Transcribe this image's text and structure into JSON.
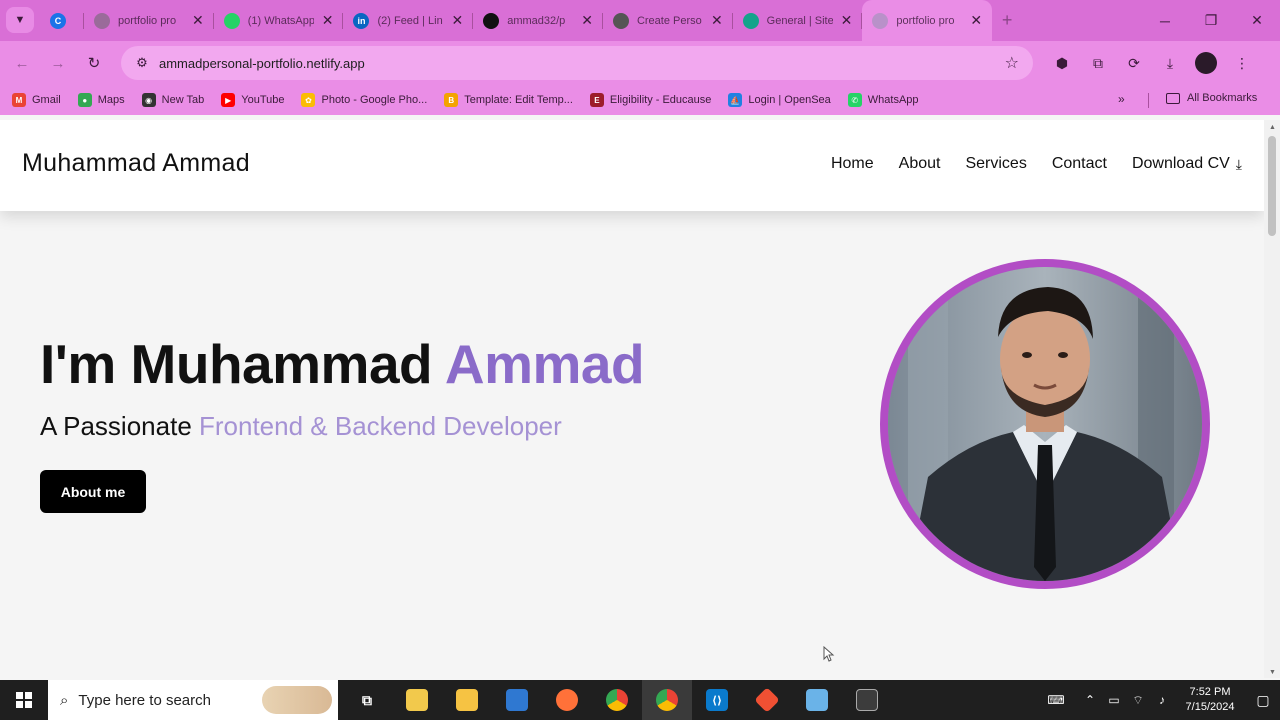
{
  "browser": {
    "tabs": [
      {
        "title": "",
        "favicon_color": "#1a73e8",
        "favicon_letter": "C"
      },
      {
        "title": "portfolio pro",
        "favicon_color": "#9a6b9a",
        "favicon_letter": ""
      },
      {
        "title": "(1) WhatsApp",
        "favicon_color": "#25d366",
        "favicon_letter": ""
      },
      {
        "title": "(2) Feed | Lin",
        "favicon_color": "#0a66c2",
        "favicon_letter": "in"
      },
      {
        "title": "ammad32/p",
        "favicon_color": "#111111",
        "favicon_letter": ""
      },
      {
        "title": "Create Perso",
        "favicon_color": "#555555",
        "favicon_letter": ""
      },
      {
        "title": "General | Site",
        "favicon_color": "#14a38b",
        "favicon_letter": ""
      },
      {
        "title": "portfolio pro",
        "favicon_color": "#b991c9",
        "favicon_letter": "",
        "active": true
      }
    ],
    "url": "ammadpersonal-portfolio.netlify.app",
    "bookmarks": [
      {
        "label": "Gmail",
        "color": "#ea4335",
        "letter": "M"
      },
      {
        "label": "Maps",
        "color": "#34a853",
        "letter": "●"
      },
      {
        "label": "New Tab",
        "color": "#333333",
        "letter": "◉"
      },
      {
        "label": "YouTube",
        "color": "#ff0000",
        "letter": "▶"
      },
      {
        "label": "Photo - Google Pho...",
        "color": "#fbbc04",
        "letter": "✿"
      },
      {
        "label": "Template: Edit Temp...",
        "color": "#f4a300",
        "letter": "B"
      },
      {
        "label": "Eligibility - Educause",
        "color": "#9c1c2b",
        "letter": "E"
      },
      {
        "label": "Login | OpenSea",
        "color": "#2081e2",
        "letter": "⛵"
      },
      {
        "label": "WhatsApp",
        "color": "#25d366",
        "letter": "✆"
      }
    ],
    "all_bookmarks": "All Bookmarks"
  },
  "site": {
    "brand": "Muhammad Ammad",
    "nav": [
      "Home",
      "About",
      "Services",
      "Contact",
      "Download CV"
    ],
    "hero": {
      "title_main": "I'm Muhammad ",
      "title_accent": "Ammad",
      "subtitle_main": "A Passionate ",
      "subtitle_accent": "Frontend & Backend Developer",
      "button": "About me"
    }
  },
  "taskbar": {
    "search_placeholder": "Type here to search",
    "time": "7:52 PM",
    "date": "7/15/2024"
  }
}
